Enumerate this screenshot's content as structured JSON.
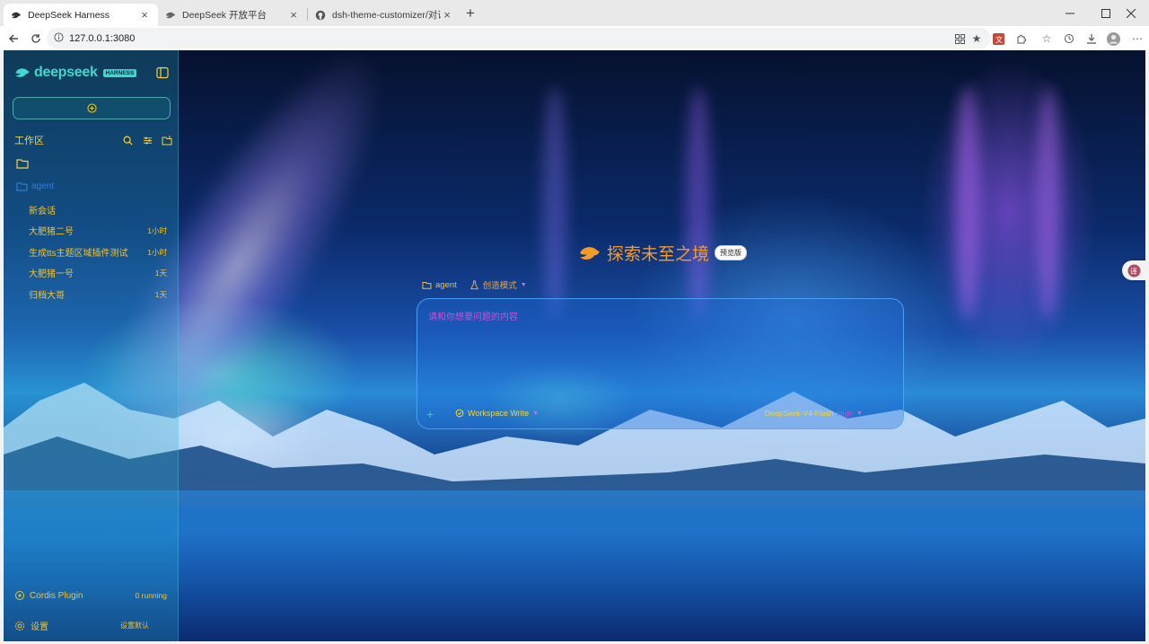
{
  "browser": {
    "tabs": [
      {
        "title": "DeepSeek Harness",
        "active": true
      },
      {
        "title": "DeepSeek 开放平台",
        "active": false
      },
      {
        "title": "dsh-theme-customizer/对话区测试",
        "active": false
      }
    ],
    "url": "127.0.0.1:3080"
  },
  "sidebar": {
    "brand_name": "deepseek",
    "brand_badge": "HARNESS",
    "workspace_title": "工作区",
    "folder_name": "agent",
    "conversations": [
      {
        "title": "新会话",
        "time": ""
      },
      {
        "title": "大肥猪二号",
        "time": "1小时"
      },
      {
        "title": "生成tts主题区域插件测试",
        "time": "1小时"
      },
      {
        "title": "大肥猪一号",
        "time": "1天"
      },
      {
        "title": "归档大哥",
        "time": "1天"
      }
    ],
    "plugin_label": "Cordis Plugin",
    "plugin_status": "0 running",
    "settings_label": "设置",
    "reset_label": "设置默认"
  },
  "main": {
    "hero_title": "探索未至之境",
    "preview_badge": "预览版",
    "folder_chip": "agent",
    "mode_chip": "创造模式",
    "composer": {
      "placeholder": "请和你想要问题的内容",
      "permission": "Workspace Write",
      "model": "DeepSeek-V4-Flash",
      "effort": "High"
    }
  },
  "colors": {
    "accent_teal": "#3ed8d0",
    "label_yellow": "#f1c332",
    "hero_orange": "#f39c2a",
    "magenta": "#d54bd6",
    "folder_blue": "#2f7de0"
  }
}
